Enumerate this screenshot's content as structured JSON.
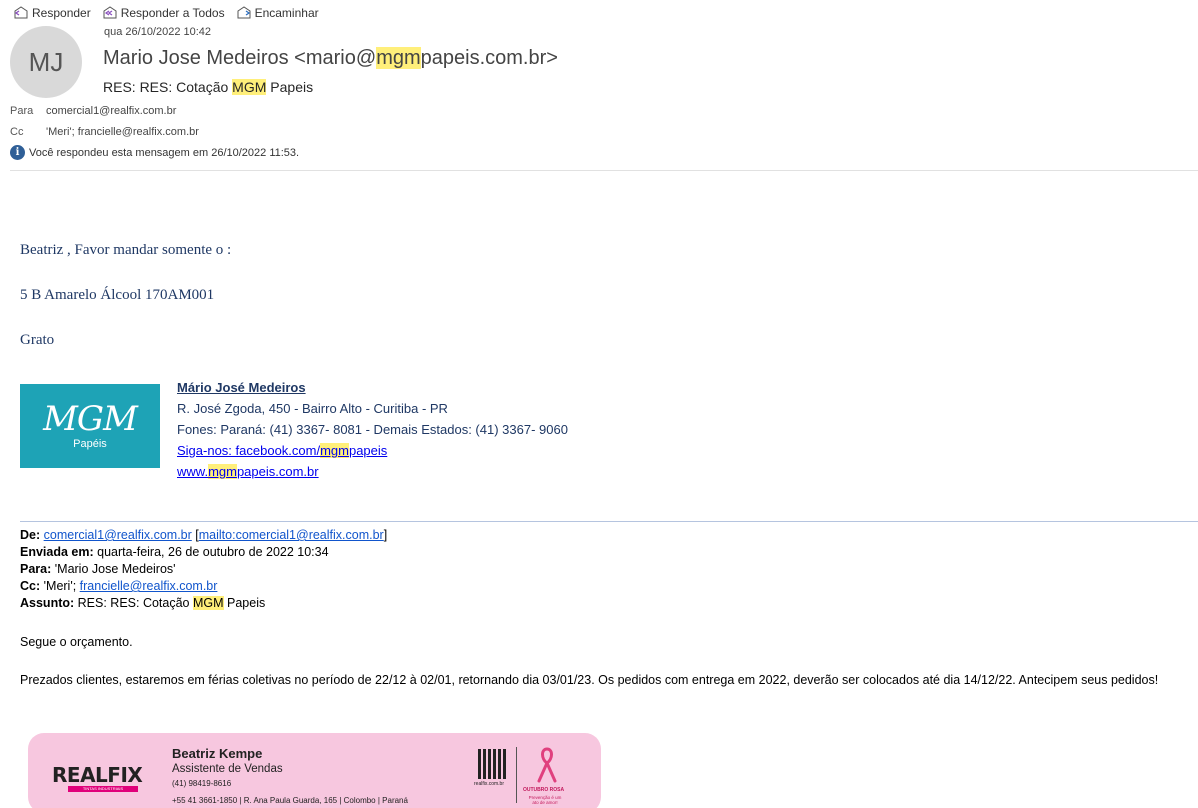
{
  "toolbar": {
    "reply": "Responder",
    "reply_all": "Responder a Todos",
    "forward": "Encaminhar"
  },
  "header": {
    "avatar_initials": "MJ",
    "date": "qua 26/10/2022 10:42",
    "sender_name_pre": "Mario Jose Medeiros <mario@",
    "sender_hl": "mgm",
    "sender_post": "papeis.com.br>",
    "subject_pre": "RES: RES: Cotação ",
    "subject_hl": "MGM",
    "subject_post": " Papeis",
    "to_label": "Para",
    "to_value": "comercial1@realfix.com.br",
    "cc_label": "Cc",
    "cc_value": "'Meri'; francielle@realfix.com.br",
    "info_text": "Você respondeu esta mensagem em 26/10/2022 11:53."
  },
  "body": {
    "line1": "Beatriz  , Favor mandar somente o :",
    "line2": "5 B Amarelo Álcool 170AM001",
    "line3": "Grato"
  },
  "signature": {
    "logo_text": "MGM",
    "logo_sub": "Papéis",
    "name": "Mário José Medeiros",
    "address": "R. José Zgoda, 450 - Bairro Alto - Curitiba - PR",
    "phones": "Fones: Paraná: (41) 3367- 8081 - Demais Estados: (41) 3367- 9060",
    "social_pre": "Siga-nos: facebook.com/",
    "social_hl": "mgm",
    "social_post": "papeis",
    "site_pre": "www.",
    "site_hl": "mgm",
    "site_post": "papeis.com.br"
  },
  "forwarded": {
    "from_label": "De:",
    "from_email": "comercial1@realfix.com.br",
    "from_mailto": "mailto:comercial1@realfix.com.br",
    "sent_label": "Enviada em:",
    "sent_value": "quarta-feira, 26 de outubro de 2022 10:34",
    "to_label": "Para:",
    "to_value": "'Mario Jose Medeiros'",
    "cc_label": "Cc:",
    "cc_value_pre": "'Meri'; ",
    "cc_email": "francielle@realfix.com.br",
    "subject_label": "Assunto:",
    "subject_pre": "RES: RES: Cotação ",
    "subject_hl": "MGM",
    "subject_post": " Papeis"
  },
  "message": {
    "p1": "Segue o orçamento.",
    "p2": "Prezados clientes, estaremos em férias coletivas no período de 22/12 à 02/01, retornando dia 03/01/23. Os pedidos com entrega em 2022, deverão ser colocados até dia 14/12/22. Antecipem seus pedidos!"
  },
  "banner": {
    "logo": "REALFIX",
    "logo_sub": "TINTAS INDUSTRIAIS",
    "name": "Beatriz Kempe",
    "role": "Assistente de Vendas",
    "phone": "(41) 98419-8616",
    "address": "+55 41 3661-1850 | R. Ana Paula Guarda, 165 | Colombo | Paraná",
    "qr_url": "realfix.com.br",
    "campaign": "OUTUBRO ROSA",
    "campaign_sub": "Prevenção é um ato de amor!"
  }
}
